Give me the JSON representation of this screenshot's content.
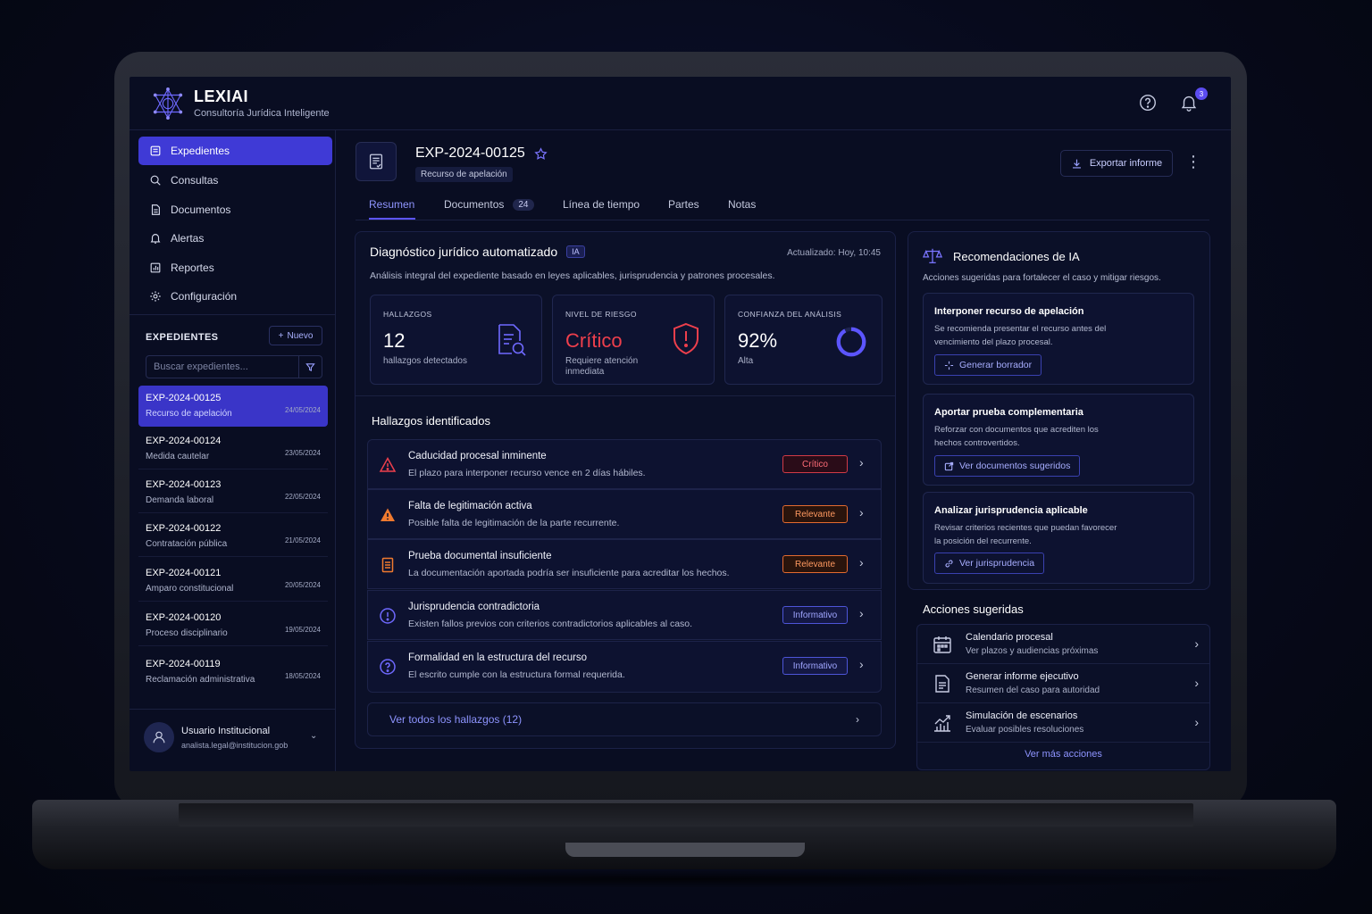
{
  "brand": {
    "name": "LEXIAI",
    "tagline": "Consultoría Jurídica Inteligente"
  },
  "header": {
    "notification_count": "3",
    "help_icon": "help-circle-icon",
    "bell_icon": "bell-icon"
  },
  "nav": [
    {
      "label": "Expedientes",
      "icon": "folder-icon",
      "active": true
    },
    {
      "label": "Consultas",
      "icon": "search-icon"
    },
    {
      "label": "Documentos",
      "icon": "document-icon"
    },
    {
      "label": "Alertas",
      "icon": "bell-icon"
    },
    {
      "label": "Reportes",
      "icon": "chart-icon"
    },
    {
      "label": "Configuración",
      "icon": "gear-icon"
    }
  ],
  "cases_section": {
    "heading": "EXPEDIENTES",
    "new_label": "Nuevo",
    "search_placeholder": "Buscar expedientes..."
  },
  "cases": [
    {
      "id": "EXP-2024-00125",
      "type": "Recurso de apelación",
      "date": "24/05/2024"
    },
    {
      "id": "EXP-2024-00124",
      "type": "Medida cautelar",
      "date": "23/05/2024"
    },
    {
      "id": "EXP-2024-00123",
      "type": "Demanda laboral",
      "date": "22/05/2024"
    },
    {
      "id": "EXP-2024-00122",
      "type": "Contratación pública",
      "date": "21/05/2024"
    },
    {
      "id": "EXP-2024-00121",
      "type": "Amparo constitucional",
      "date": "20/05/2024"
    },
    {
      "id": "EXP-2024-00120",
      "type": "Proceso disciplinario",
      "date": "19/05/2024"
    },
    {
      "id": "EXP-2024-00119",
      "type": "Reclamación administrativa",
      "date": "18/05/2024"
    }
  ],
  "user": {
    "name": "Usuario Institucional",
    "email": "analista.legal@institucion.gob"
  },
  "case_header": {
    "id": "EXP-2024-00125",
    "type": "Recurso de apelación",
    "export_label": "Exportar informe"
  },
  "tabs": [
    {
      "label": "Resumen",
      "active": true
    },
    {
      "label": "Documentos",
      "count": "24"
    },
    {
      "label": "Línea de tiempo"
    },
    {
      "label": "Partes"
    },
    {
      "label": "Notas"
    }
  ],
  "diagnosis": {
    "title": "Diagnóstico jurídico automatizado",
    "tag": "IA",
    "updated": "Actualizado: Hoy, 10:45",
    "description": "Análisis integral del expediente basado en leyes aplicables, jurisprudencia y patrones procesales.",
    "stats": {
      "findings": {
        "label": "HALLAZGOS",
        "value": "12",
        "sub": "hallazgos detectados"
      },
      "risk": {
        "label": "NIVEL DE RIESGO",
        "value": "Crítico",
        "sub": "Requiere atención inmediata"
      },
      "confidence": {
        "label": "CONFIANZA DEL ANÁLISIS",
        "value": "92%",
        "sub": "Alta",
        "fraction": 0.92
      }
    }
  },
  "findings": {
    "title": "Hallazgos identificados",
    "items": [
      {
        "title": "Caducidad procesal inminente",
        "desc": "El plazo para interponer recurso vence en 2 días hábiles.",
        "badge": "Crítico",
        "level": "crit",
        "icon": "warning-triangle-icon"
      },
      {
        "title": "Falta de legitimación activa",
        "desc": "Posible falta de legitimación de la parte recurrente.",
        "badge": "Relevante",
        "level": "rel",
        "icon": "warning-filled-icon"
      },
      {
        "title": "Prueba documental insuficiente",
        "desc": "La documentación aportada podría ser insuficiente para acreditar los hechos.",
        "badge": "Relevante",
        "level": "rel",
        "icon": "document-icon"
      },
      {
        "title": "Jurisprudencia contradictoria",
        "desc": "Existen fallos previos con criterios contradictorios aplicables al caso.",
        "badge": "Informativo",
        "level": "info",
        "icon": "info-circle-icon"
      },
      {
        "title": "Formalidad en la estructura del recurso",
        "desc": "El escrito cumple con la estructura formal requerida.",
        "badge": "Informativo",
        "level": "info",
        "icon": "question-circle-icon"
      }
    ],
    "see_all": "Ver todos los hallazgos (12)"
  },
  "recommendations": {
    "title": "Recomendaciones de IA",
    "description": "Acciones sugeridas para fortalecer el caso y mitigar riesgos.",
    "items": [
      {
        "title": "Interponer recurso de apelación",
        "desc": "Se recomienda presentar el recurso antes del vencimiento del plazo procesal.",
        "button": "Generar borrador"
      },
      {
        "title": "Aportar prueba complementaria",
        "desc": "Reforzar con documentos que acrediten los hechos controvertidos.",
        "button": "Ver documentos sugeridos"
      },
      {
        "title": "Analizar jurisprudencia aplicable",
        "desc": "Revisar criterios recientes que puedan favorecer la posición del recurrente.",
        "button": "Ver jurisprudencia"
      }
    ]
  },
  "actions": {
    "title": "Acciones sugeridas",
    "items": [
      {
        "title": "Calendario procesal",
        "desc": "Ver plazos y audiencias próximas",
        "icon": "calendar-icon"
      },
      {
        "title": "Generar informe ejecutivo",
        "desc": "Resumen del caso para autoridad",
        "icon": "report-icon"
      },
      {
        "title": "Simulación de escenarios",
        "desc": "Evaluar posibles resoluciones",
        "icon": "chart-trend-icon"
      }
    ],
    "more": "Ver más acciones"
  },
  "colors": {
    "accent": "#3f3ad6",
    "critical": "#ee3f4c",
    "relevant": "#e46a2f",
    "info": "#4d55d8",
    "background": "#090d22"
  }
}
